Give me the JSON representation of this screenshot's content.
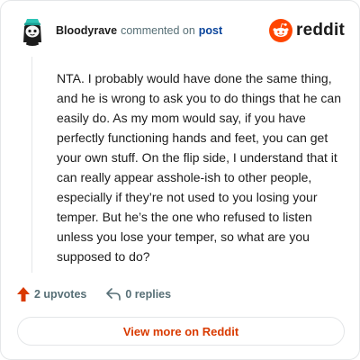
{
  "header": {
    "username": "Bloodyrave",
    "action_text": "commented on",
    "post_link_label": "post",
    "brand_wordmark": "reddit"
  },
  "comment": {
    "body": "NTA. I probably would have done the same thing, and he is wrong to ask you to do things that he can easily do. As my mom would say, if you have perfectly functioning hands and feet, you can get your own stuff. On the flip side, I understand that it can really appear asshole-ish to other people, especially if they’re not used to you losing your temper. But he’s the one who refused to listen unless you lose your temper, so what are you supposed to do?"
  },
  "actions": {
    "upvotes_label": "2 upvotes",
    "replies_label": "0 replies"
  },
  "footer": {
    "view_more_label": "View more on Reddit"
  },
  "colors": {
    "brand_orange": "#ff4500",
    "upvote_orange": "#d93a00",
    "link_blue": "#0a449b",
    "meta_gray": "#576f76",
    "border": "#e4e6e8"
  },
  "icons": {
    "avatar": "snoo-avatar",
    "logo": "reddit-snoo-logo",
    "upvote": "upvote-arrow-icon",
    "reply": "reply-arrow-icon"
  }
}
